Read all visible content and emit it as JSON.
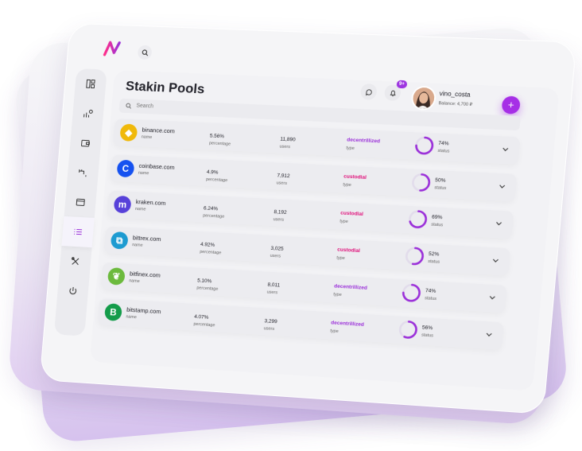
{
  "header": {
    "title": "Stakin Pools",
    "notification_badge": "9+",
    "user": {
      "name": "vino_costa",
      "balance": "Balance: 4,700 ₽"
    },
    "add_label": "+"
  },
  "search": {
    "placeholder": "Search"
  },
  "sidebar": {
    "items": [
      {
        "icon": "dashboard-icon"
      },
      {
        "icon": "stats-icon"
      },
      {
        "icon": "wallet-icon"
      },
      {
        "icon": "faucet-icon"
      },
      {
        "icon": "window-icon"
      },
      {
        "icon": "list-icon",
        "active": true
      },
      {
        "icon": "tools-icon"
      },
      {
        "icon": "power-icon"
      }
    ]
  },
  "columns": {
    "name": "name",
    "percentage": "percentage",
    "users": "users",
    "type": "type",
    "status": "status"
  },
  "pools": [
    {
      "name": "binance.com",
      "percentage": "5.56%",
      "users": "11,890",
      "type": "decentrillized",
      "status": "74%",
      "status_value": 74,
      "coin_color": "#f0b90b",
      "type_color": "#9b30d9"
    },
    {
      "name": "coinbase.com",
      "percentage": "4.9%",
      "users": "7,912",
      "type": "custodial",
      "status": "50%",
      "status_value": 50,
      "coin_color": "#1652f0",
      "type_color": "#e0107a"
    },
    {
      "name": "kraken.com",
      "percentage": "6.24%",
      "users": "8,192",
      "type": "custodial",
      "status": "69%",
      "status_value": 69,
      "coin_color": "#5741d9",
      "type_color": "#e0107a"
    },
    {
      "name": "bittrex.com",
      "percentage": "4.92%",
      "users": "3,025",
      "type": "custodial",
      "status": "52%",
      "status_value": 52,
      "coin_color": "#1d9bd1",
      "type_color": "#e0107a"
    },
    {
      "name": "bitfinex.com",
      "percentage": "5.10%",
      "users": "8,011",
      "type": "decentrillized",
      "status": "74%",
      "status_value": 74,
      "coin_color": "#6cba3d",
      "type_color": "#9b30d9"
    },
    {
      "name": "bitstamp.com",
      "percentage": "4.07%",
      "users": "3,299",
      "type": "decentrillized",
      "status": "56%",
      "status_value": 56,
      "coin_color": "#149c4a",
      "type_color": "#9b30d9"
    }
  ],
  "colors": {
    "accent": "#a62fe6",
    "ring": "#9b30d9",
    "ring_track": "#e2dceb"
  }
}
